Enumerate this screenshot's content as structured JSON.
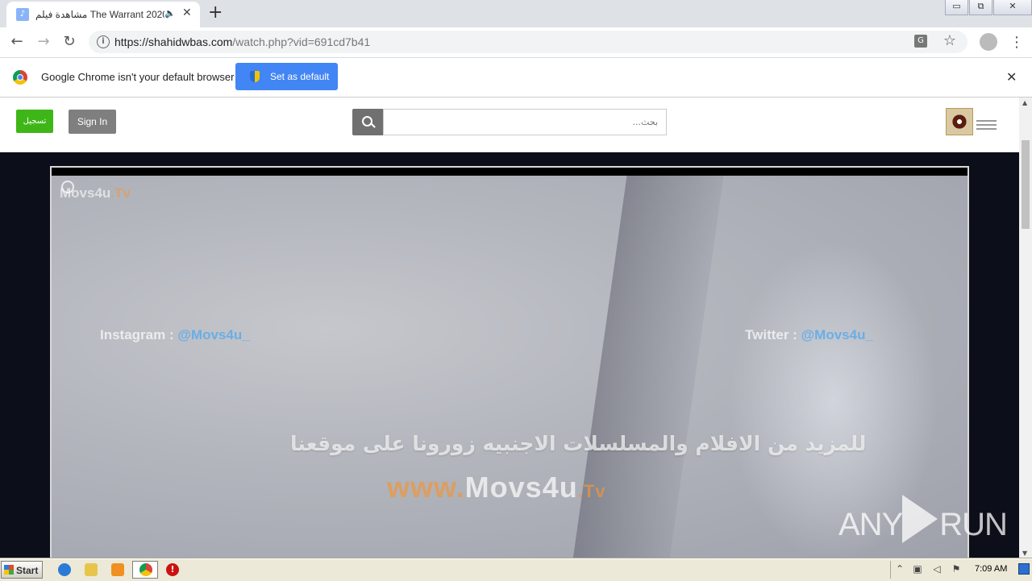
{
  "browser": {
    "tab_title": "مشاهدة فيلم The Warrant 2020",
    "tab_favicon": "music-note",
    "tab_audio_icon": "speaker-icon",
    "new_tab_icon": "+",
    "url_host": "https://shahidwbas.com",
    "url_path": "/watch.php?vid=691cd7b41",
    "back_icon": "←",
    "forward_icon": "→",
    "reload_icon": "↻",
    "translate_icon": "G",
    "star_icon": "☆",
    "menu_icon": "⋮",
    "win_minimize": "▭",
    "win_maximize": "⧉",
    "win_close": "✕"
  },
  "infobar": {
    "message": "Google Chrome isn't your default browser",
    "button_label": "Set as default",
    "close_icon": "✕"
  },
  "site": {
    "register_label": "تسجيل",
    "signin_label": "Sign In",
    "search_placeholder": "بحث...",
    "colors": {
      "register": "#3fb618",
      "signin": "#7f7f7f",
      "search_button": "#707070",
      "page_bg": "#0c0f1a"
    }
  },
  "video": {
    "watermark_logo_main": "Movs4u",
    "watermark_logo_suffix": ".Tv",
    "instagram_label": "Instagram : ",
    "instagram_handle": "@Movs4u_",
    "twitter_label": "Twitter : ",
    "twitter_handle": "@Movs4u_",
    "arabic_caption": "للمزيد من الافلام والمسلسلات الاجنبيه زورونا على موقعنا",
    "site_prefix": "www.",
    "site_name": "Movs4u",
    "site_suffix": ".Tv"
  },
  "overlay": {
    "brand_left": "ANY",
    "brand_right": "RUN"
  },
  "taskbar": {
    "start_label": "Start",
    "alert_icon": "!",
    "clock": "7:09 AM",
    "tray_icons": [
      "chevron-up",
      "network-icon",
      "volume-icon",
      "flag-icon"
    ]
  }
}
